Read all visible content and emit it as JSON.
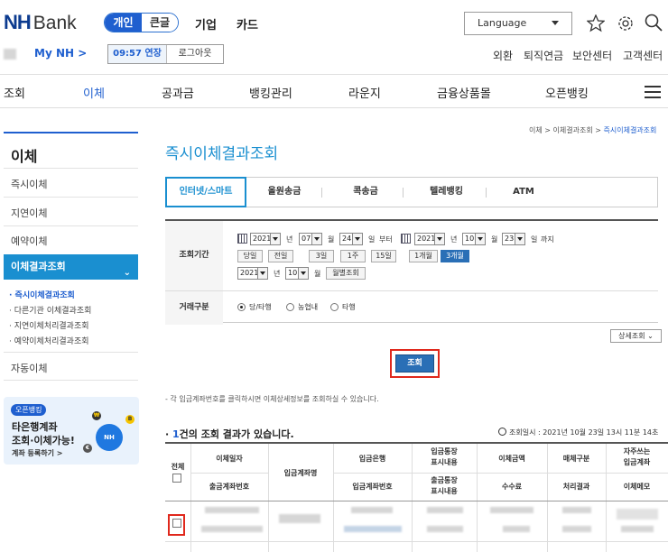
{
  "header": {
    "logo_nh": "NH",
    "logo_bank": "Bank",
    "tab_personal": "개인",
    "tab_large": "큰글",
    "nav_corp": "기업",
    "nav_card": "카드",
    "language": "Language"
  },
  "user": {
    "mynh": "My NH >",
    "timer": "09:57 연장",
    "logout": "로그아웃"
  },
  "utils": [
    "외환",
    "퇴직연금",
    "보안센터",
    "고객센터"
  ],
  "gnb": [
    "조회",
    "이체",
    "공과금",
    "뱅킹관리",
    "라운지",
    "금융상품몰",
    "오픈뱅킹"
  ],
  "lnb": {
    "title": "이체",
    "items": [
      "즉시이체",
      "지연이체",
      "예약이체"
    ],
    "active": "이체결과조회",
    "subs": [
      "· 즉시이체결과조회",
      "· 다른기관 이체결과조회",
      "· 지연이체처리결과조회",
      "· 예약이체처리결과조회"
    ],
    "last": "자동이체"
  },
  "banner": {
    "tag": "오픈뱅킹",
    "line1": "타은행계좌",
    "line2": "조회·이체가능!",
    "line3": "계좌 등록하기 >",
    "coin_text": "NH"
  },
  "breadcrumb": {
    "a": "이체",
    "b": "이체결과조회",
    "c": "즉시이체결과조회",
    "sep": ">"
  },
  "page_title": "즉시이체결과조회",
  "tabs": [
    "인터넷/스마트",
    "올원송금",
    "콕송금",
    "텔레뱅킹",
    "ATM"
  ],
  "form": {
    "period_label": "조회기간",
    "from": {
      "year": "2021",
      "month": "07",
      "day": "24"
    },
    "to": {
      "year": "2021",
      "month": "10",
      "day": "23"
    },
    "unit_year": "년",
    "unit_month": "월",
    "unit_day": "일",
    "from_suffix": "부터",
    "to_suffix": "까지",
    "quick": [
      "당일",
      "전일",
      "3일",
      "1주",
      "15일",
      "1개월",
      "3개월"
    ],
    "monthly": {
      "year": "2021",
      "month": "10",
      "button": "월별조회"
    },
    "type_label": "거래구분",
    "radios": [
      "당/타행",
      "농협내",
      "타행"
    ]
  },
  "detail_button": "상세조회",
  "query_button": "조회",
  "note": "- 각 입금계좌번호를 클릭하시면 이체상세정보를 조회하실 수 있습니다.",
  "result": {
    "prefix": "· ",
    "count": "1",
    "suffix": "건의 조회 결과가 있습니다.",
    "time": "조회일시 : 2021년 10월 23일 13시 11분 14초"
  },
  "table": {
    "all": "전체",
    "headers_top": [
      "이체일자",
      "입금계좌명",
      "입금은행",
      "입금통장\n표시내용",
      "이체금액",
      "매체구분",
      "자주쓰는\n입금계좌"
    ],
    "headers_bottom": [
      "출금계좌번호",
      "입금계좌번호",
      "출금통장\n표시내용",
      "수수료",
      "처리결과",
      "이체메모"
    ]
  }
}
